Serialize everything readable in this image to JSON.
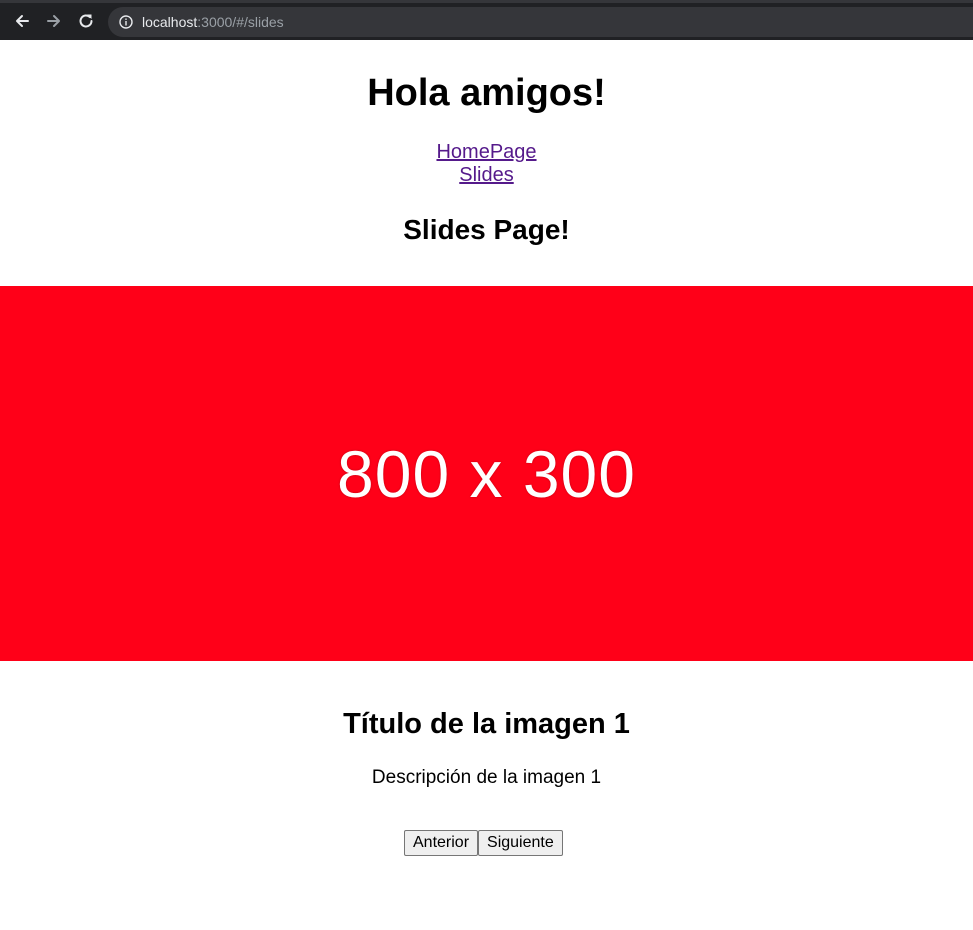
{
  "browser": {
    "url_host": "localhost",
    "url_rest": ":3000/#/slides",
    "toolbar_color": "#202124"
  },
  "header": {
    "title": "Hola amigos!"
  },
  "nav": {
    "links": [
      {
        "label": "HomePage"
      },
      {
        "label": "Slides"
      }
    ]
  },
  "page": {
    "title": "Slides Page!"
  },
  "slide": {
    "image_label": "800 x 300",
    "image_color": "#ff0018",
    "title": "Título de la imagen 1",
    "description": "Descripción de la imagen 1"
  },
  "controls": {
    "prev_label": "Anterior",
    "next_label": "Siguiente"
  },
  "icons": [
    "back-arrow-icon",
    "forward-arrow-icon",
    "reload-icon",
    "info-icon"
  ]
}
